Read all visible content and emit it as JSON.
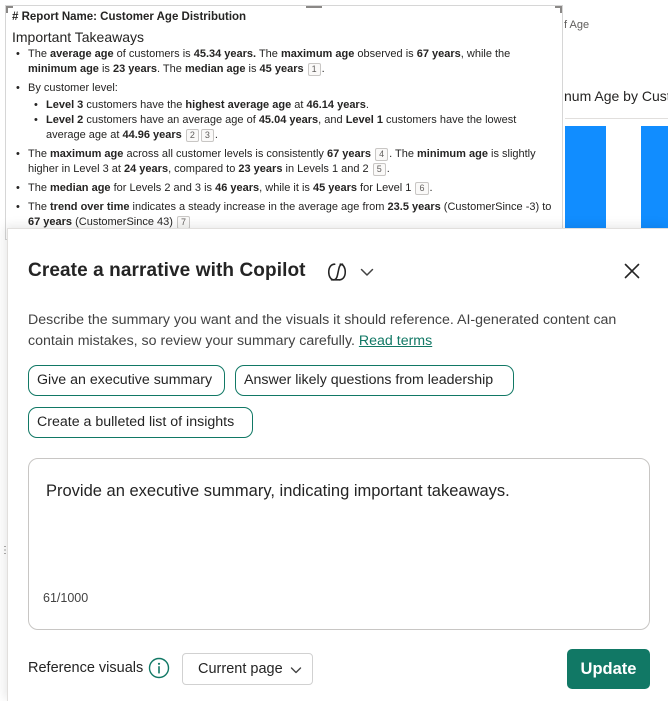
{
  "report": {
    "report_name": "# Report Name: Customer Age Distribution",
    "takeaways_title": "Important Takeaways",
    "b1": {
      "t1": "The ",
      "k1": "average age",
      "t2": " of customers is ",
      "k2": "45.34 years.",
      "t3": " The ",
      "k3": "maximum age",
      "t4": " observed is ",
      "k4": "67 years",
      "t5": ", while the ",
      "k5": "minimum age",
      "t6": " is ",
      "k6": "23 years",
      "t7": ". The ",
      "k7": "median age",
      "t8": " is ",
      "k8": "45 years",
      "r1": "1",
      "t9": "."
    },
    "b2": {
      "intro": "By customer level:",
      "s1": {
        "k1": "Level 3",
        "t1": " customers have the ",
        "k2": "highest average age",
        "t2": " at ",
        "k3": "46.14 years",
        "t3": "."
      },
      "s2": {
        "k1": "Level 2",
        "t1": " customers have an average age of ",
        "k2": "45.04 years",
        "t2": ", and ",
        "k3": "Level 1",
        "t3": " customers have the lowest average age at ",
        "k4": "44.96 years",
        "r1": "2",
        "r2": "3",
        "t4": "."
      }
    },
    "b3": {
      "t1": "The ",
      "k1": "maximum age",
      "t2": " across all customer levels is consistently ",
      "k2": "67 years",
      "r1": "4",
      "t3": ". The ",
      "k3": "minimum age",
      "t4": " is slightly higher in Level 3 at ",
      "k4": "24 years",
      "t5": ", compared to ",
      "k5": "23 years",
      "t6": " in Levels 1 and 2",
      "r2": "5",
      "t7": "."
    },
    "b4": {
      "t1": "The ",
      "k1": "median age",
      "t2": " for Levels 2 and 3 is ",
      "k2": "46 years",
      "t3": ", while it is ",
      "k3": "45 years",
      "t4": " for Level 1",
      "r1": "6",
      "t5": "."
    },
    "b5": {
      "t1": "The ",
      "k1": "trend over time",
      "t2": " indicates a steady increase in the average age from ",
      "k2": "23.5 years",
      "t3": " (CustomerSince -3) to ",
      "k3": "67 years",
      "t4": " (CustomerSince 43)",
      "r1": "7"
    }
  },
  "background_visuals": {
    "title_1": "f Age",
    "title_2": "num Age by Cust",
    "bar_color": "#118dff"
  },
  "panel": {
    "title": "Create a narrative with Copilot",
    "description": "Describe the summary you want and the visuals it should reference. AI-generated content can contain mistakes, so review your summary carefully. ",
    "read_terms": "Read terms",
    "suggestions": [
      "Give an executive summary",
      "Answer likely questions from leadership",
      "Create a bulleted list of insights"
    ],
    "prompt": {
      "value": "Provide an executive summary, indicating important takeaways.",
      "char_count": "61/1000"
    },
    "reference_visuals_label": "Reference visuals",
    "reference_select_value": "Current page",
    "update_label": "Update",
    "accent_color": "#117865"
  }
}
